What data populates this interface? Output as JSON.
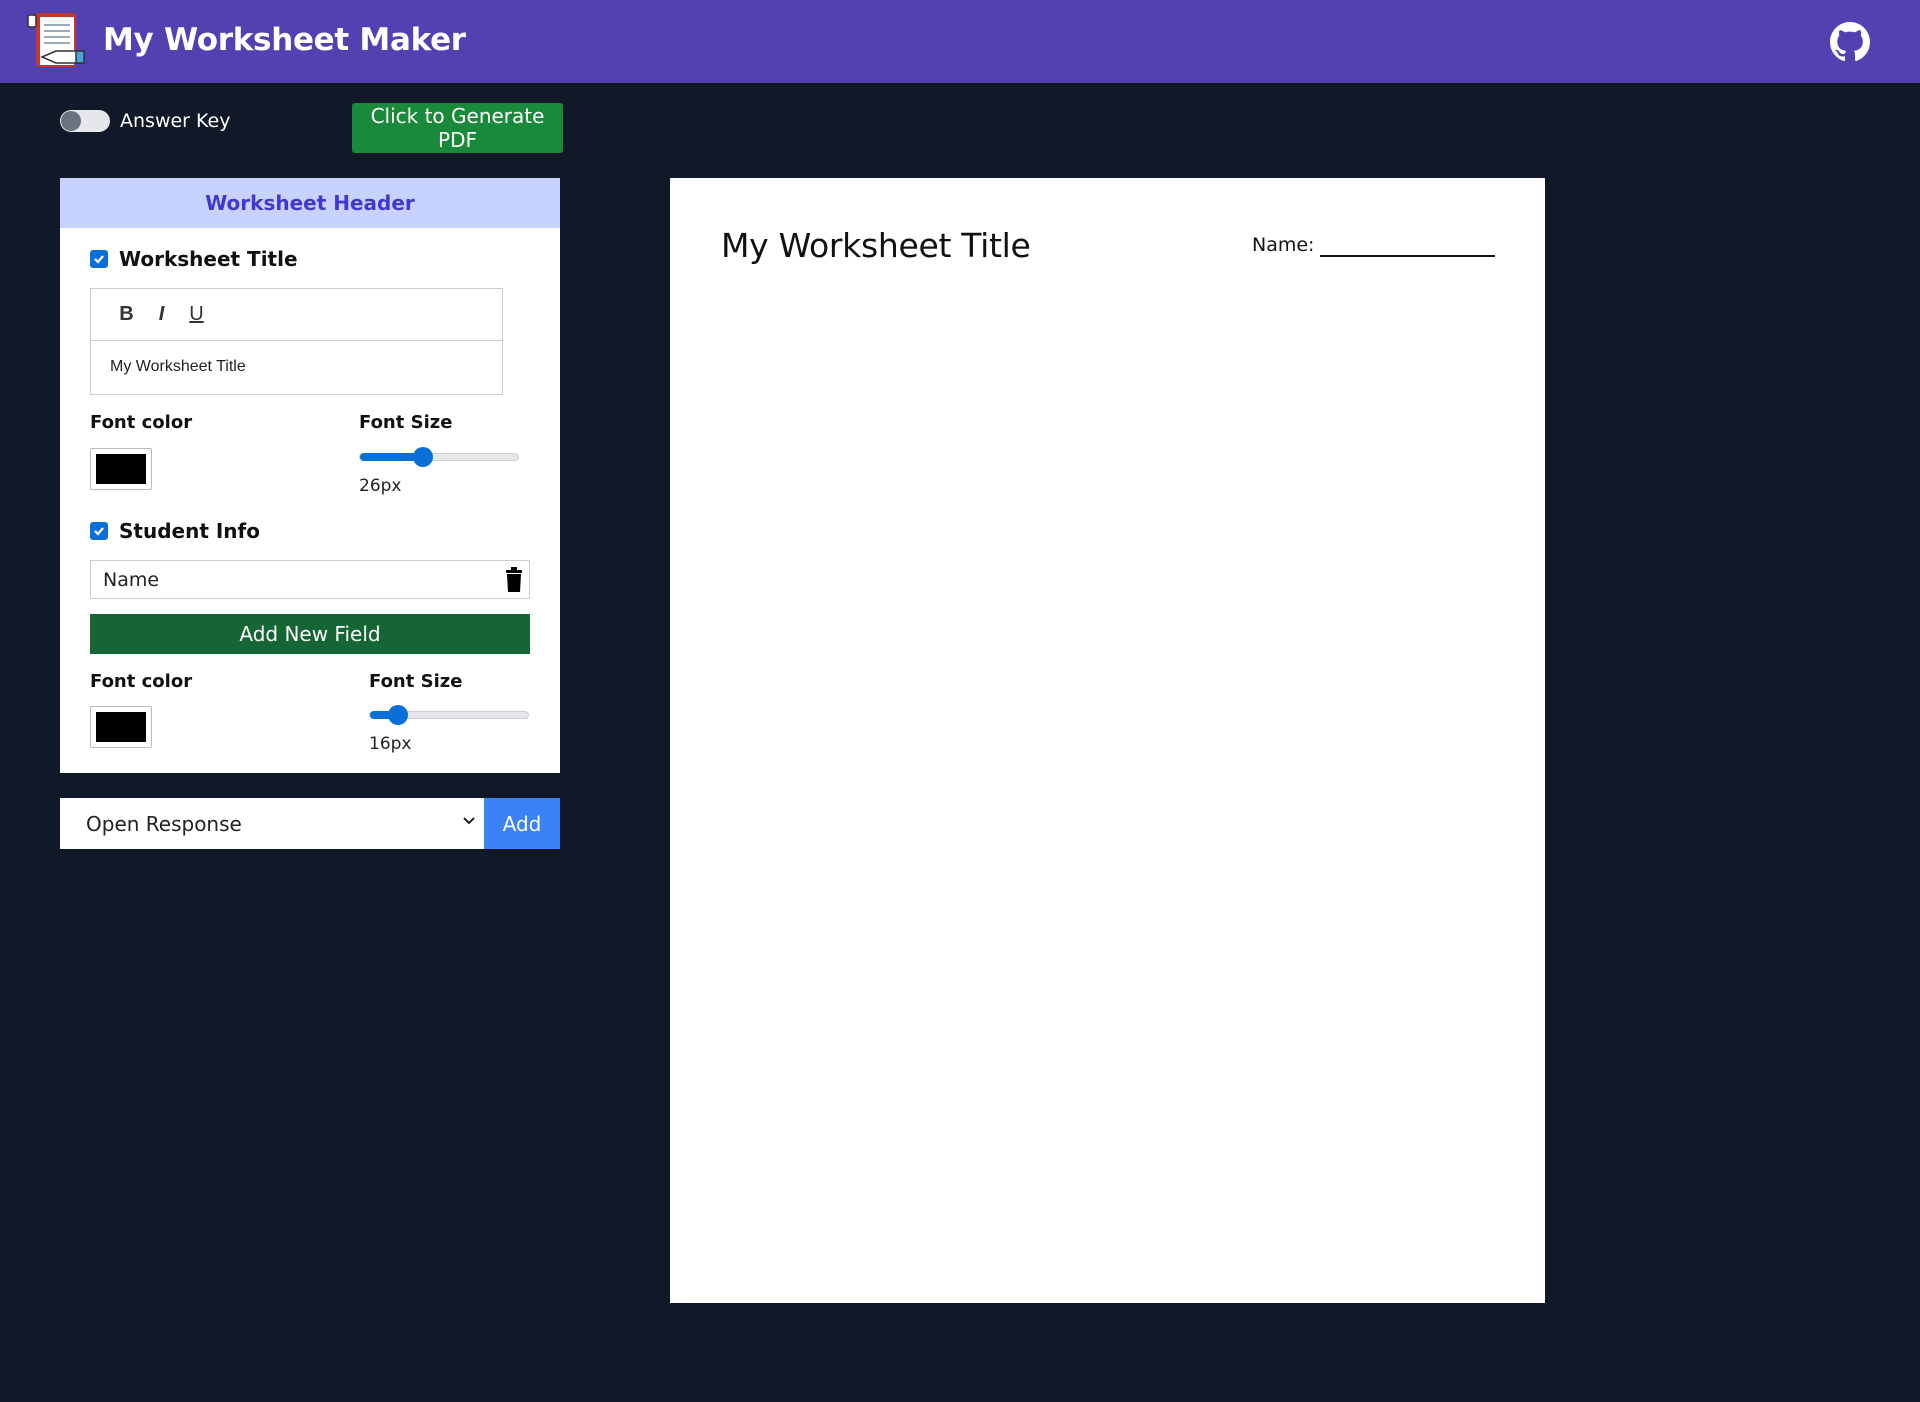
{
  "app": {
    "title": "My Worksheet Maker",
    "logo_icon": "worksheet-notepad-logo",
    "github_icon": "github-icon",
    "colors": {
      "topbar": "#5241b0",
      "background": "#111827"
    }
  },
  "controls": {
    "answer_key_label": "Answer Key",
    "answer_key_on": false,
    "generate_pdf_label": "Click to Generate PDF"
  },
  "panel": {
    "header": "Worksheet Header",
    "worksheet_title": {
      "label": "Worksheet Title",
      "checked": true,
      "toolbar": {
        "bold": "B",
        "italic": "I",
        "underline": "U"
      },
      "text": "My Worksheet Title",
      "font_color_label": "Font color",
      "font_color": "#000000",
      "font_size_label": "Font Size",
      "font_size_value": "26px",
      "font_size_fraction": 0.4
    },
    "student_info": {
      "label": "Student Info",
      "checked": true,
      "fields": [
        "Name"
      ],
      "add_field_label": "Add New Field",
      "font_color_label": "Font color",
      "font_color": "#000000",
      "font_size_label": "Font Size",
      "font_size_value": "16px",
      "font_size_fraction": 0.18
    }
  },
  "question": {
    "selected_type": "Open Response",
    "add_label": "Add"
  },
  "preview": {
    "title": "My Worksheet Title",
    "name_label": "Name:"
  }
}
